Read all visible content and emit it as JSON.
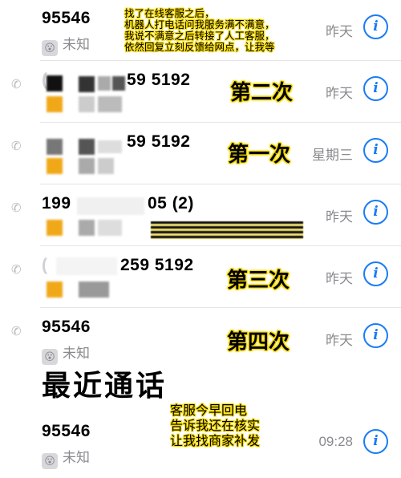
{
  "calls": [
    {
      "number": "95546",
      "label": "未知",
      "time": "昨天"
    },
    {
      "number": "59 5192",
      "time": "昨天"
    },
    {
      "number": "59 5192",
      "time": "星期三"
    },
    {
      "number_left": "199",
      "number": "05 (2)",
      "time": "昨天"
    },
    {
      "number": "259 5192",
      "time": "昨天"
    },
    {
      "number": "95546",
      "label": "未知",
      "time": "昨天"
    },
    {
      "number": "95546",
      "label": "未知",
      "time": "09:28"
    }
  ],
  "section_title": "最近通话",
  "annotations": {
    "top_note": [
      "找了在线客服之后，",
      "机器人打电话问我服务满不满意，",
      "我说不满意之后转接了人工客服，",
      "依然回复立刻反馈给网点，让我等"
    ],
    "second": "第二次",
    "first": "第一次",
    "third": "第三次",
    "fourth": "第四次",
    "bottom_note": [
      "客服今早回电",
      "告诉我还在核实",
      "让我找商家补发"
    ]
  },
  "icons": {
    "info": "info-icon",
    "phone": "phone-icon"
  },
  "colors": {
    "accent": "#1a7cf5",
    "highlight": "#f2d700",
    "secondary_text": "#8a8a8e"
  }
}
